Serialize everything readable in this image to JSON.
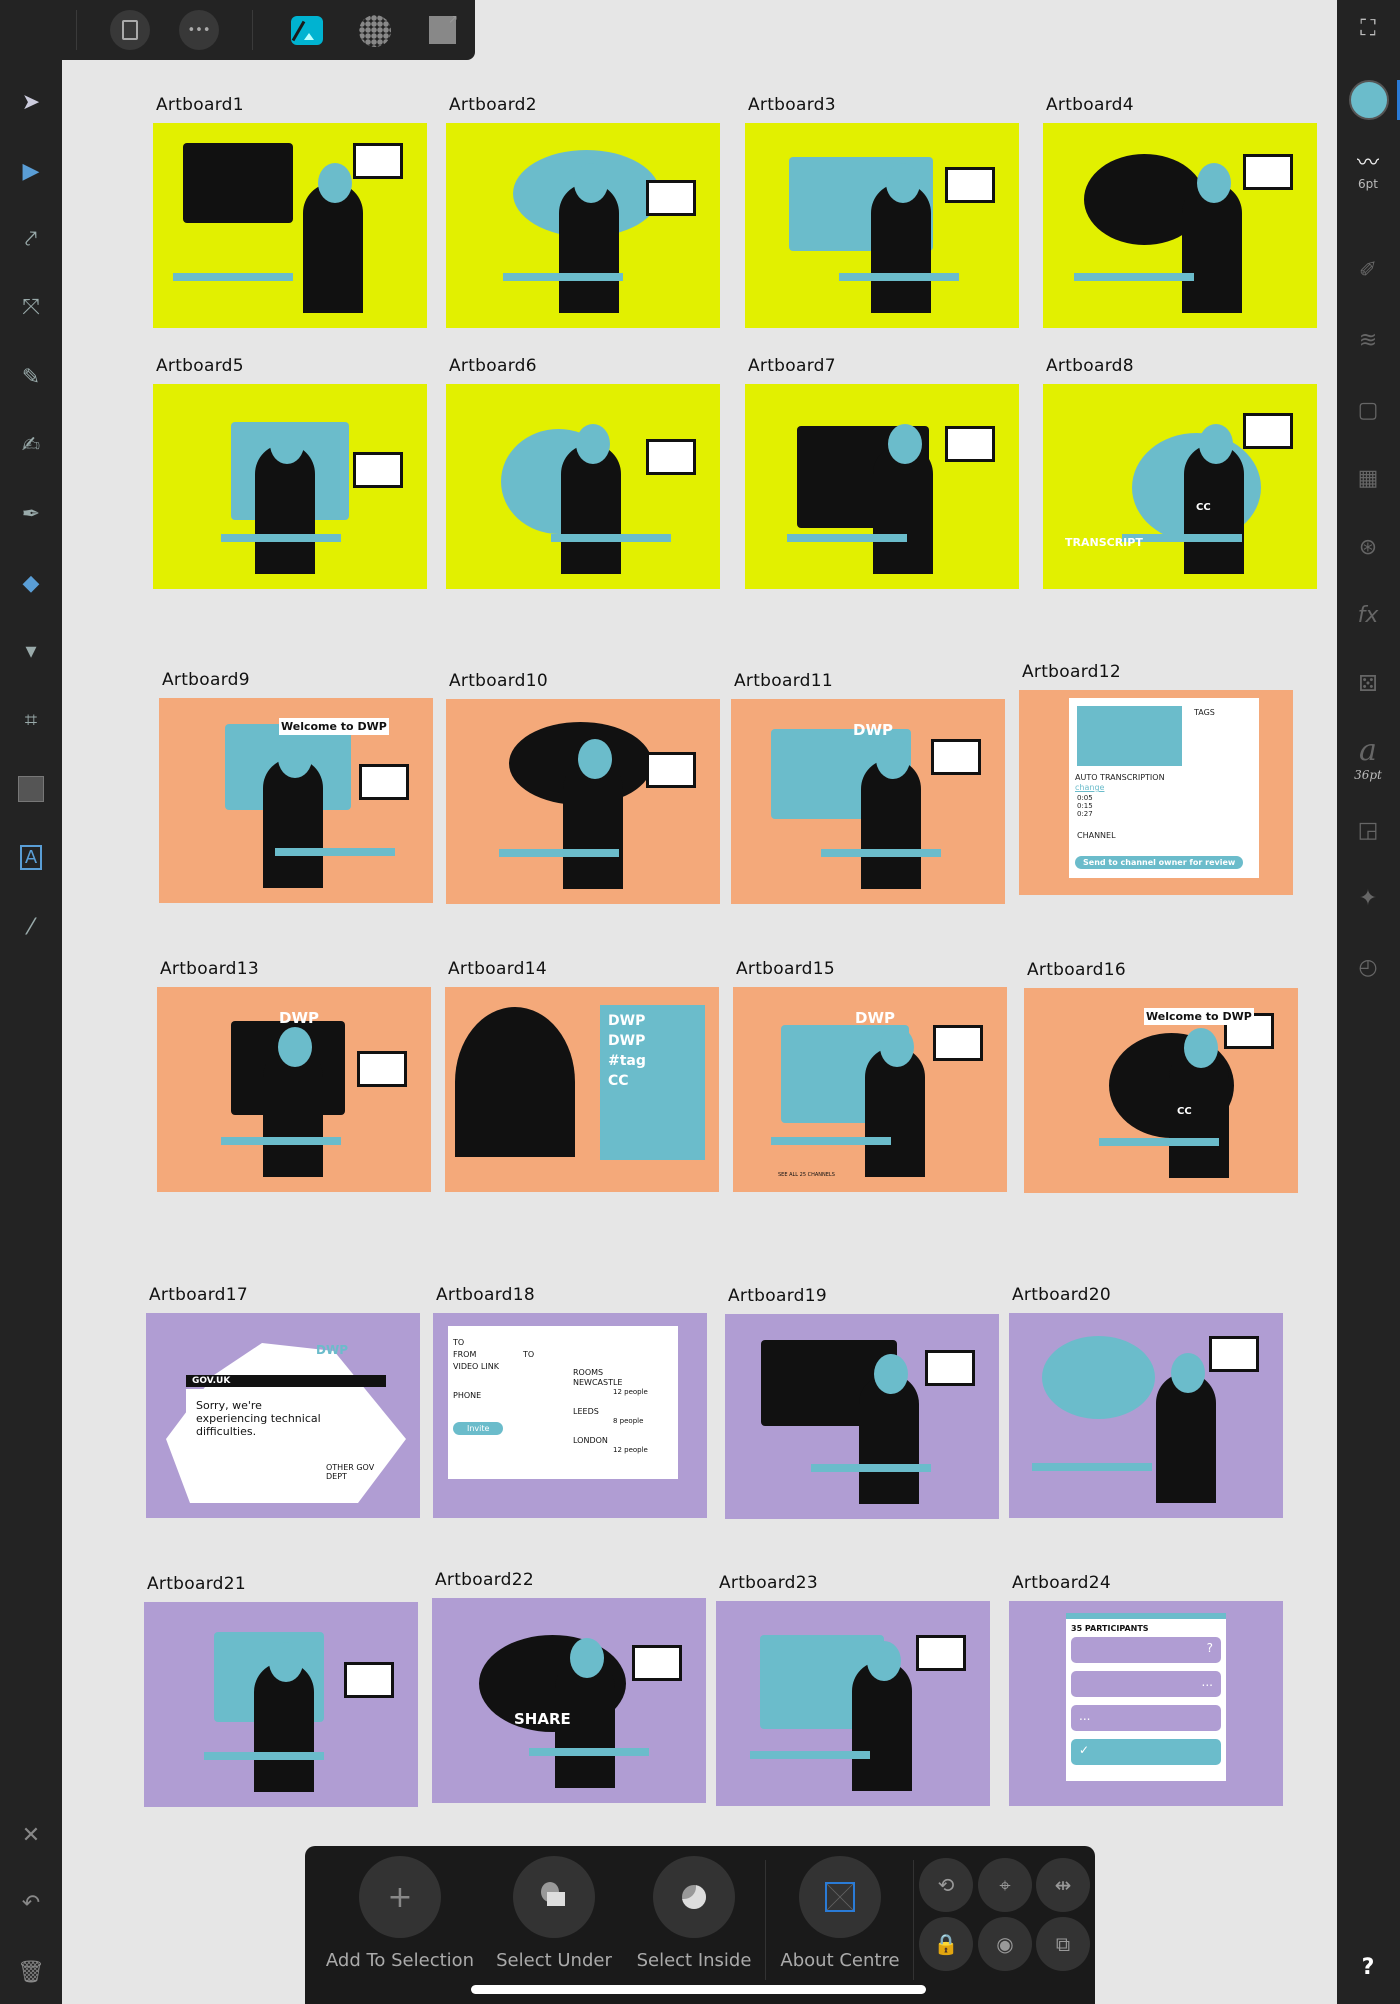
{
  "app": {
    "accent": "#00b3d1"
  },
  "topbar": {
    "icons": [
      "back-arrow-icon",
      "document-menu-icon",
      "more-icon",
      "designer-persona-icon",
      "pixel-persona-icon",
      "export-persona-icon"
    ],
    "more": "•••"
  },
  "left_tools": [
    "move-tool",
    "node-tool",
    "corner-tool",
    "point-transform-tool",
    "pencil-tool",
    "vector-brush-tool",
    "pen-tool",
    "fill-tool",
    "transparency-tool",
    "crop-tool",
    "shape-tool",
    "text-tool",
    "color-picker-tool"
  ],
  "right_panel": {
    "stroke_width": "6pt",
    "font_size": "36pt",
    "fill_color": "#6bbccb",
    "fx": "fx",
    "font_glyph": "a"
  },
  "theme_colors": {
    "yellow": "#e2f000",
    "orange": "#f4a97a",
    "purple": "#b09dd3",
    "teal": "#6bbccb",
    "black": "#111111"
  },
  "artboards": [
    {
      "name": "Artboard1",
      "theme": "yellow"
    },
    {
      "name": "Artboard2",
      "theme": "yellow"
    },
    {
      "name": "Artboard3",
      "theme": "yellow"
    },
    {
      "name": "Artboard4",
      "theme": "yellow"
    },
    {
      "name": "Artboard5",
      "theme": "yellow"
    },
    {
      "name": "Artboard6",
      "theme": "yellow"
    },
    {
      "name": "Artboard7",
      "theme": "yellow"
    },
    {
      "name": "Artboard8",
      "theme": "yellow",
      "text": "TRANSCRIPT",
      "cc": "CC"
    },
    {
      "name": "Artboard9",
      "theme": "orange",
      "text": "Welcome to DWP"
    },
    {
      "name": "Artboard10",
      "theme": "orange"
    },
    {
      "name": "Artboard11",
      "theme": "orange",
      "text": "DWP"
    },
    {
      "name": "Artboard12",
      "theme": "orange",
      "panel": {
        "tags": "TAGS",
        "auto": "AUTO TRANSCRIPTION",
        "change": "change",
        "times": [
          "0:05",
          "0:15",
          "0:27"
        ],
        "channel": "CHANNEL",
        "button": "Send to channel owner for review"
      }
    },
    {
      "name": "Artboard13",
      "theme": "orange",
      "text": "DWP"
    },
    {
      "name": "Artboard14",
      "theme": "orange",
      "list": [
        "DWP",
        "DWP",
        "#tag",
        "CC"
      ]
    },
    {
      "name": "Artboard15",
      "theme": "orange",
      "text": "DWP",
      "sub": "SEE ALL 25 CHANNELS"
    },
    {
      "name": "Artboard16",
      "theme": "orange",
      "text": "Welcome to DWP",
      "cc": "CC"
    },
    {
      "name": "Artboard17",
      "theme": "purple",
      "panel": {
        "dwp": "DWP",
        "govuk": "GOV.UK",
        "message": "Sorry, we're experiencing technical difficulties.",
        "other": "OTHER GOV DEPT"
      }
    },
    {
      "name": "Artboard18",
      "theme": "purple",
      "panel": {
        "to": "TO",
        "from": "FROM",
        "to2": "TO",
        "video": "VIDEO LINK",
        "phone": "PHONE",
        "invite": "Invite",
        "rooms": "ROOMS",
        "locations": [
          {
            "city": "NEWCASTLE",
            "people": "12 people"
          },
          {
            "city": "LEEDS",
            "people": "8 people"
          },
          {
            "city": "LONDON",
            "people": "12 people"
          }
        ]
      }
    },
    {
      "name": "Artboard19",
      "theme": "purple"
    },
    {
      "name": "Artboard20",
      "theme": "purple"
    },
    {
      "name": "Artboard21",
      "theme": "purple"
    },
    {
      "name": "Artboard22",
      "theme": "purple",
      "text": "SHARE"
    },
    {
      "name": "Artboard23",
      "theme": "purple"
    },
    {
      "name": "Artboard24",
      "theme": "purple",
      "panel": {
        "title": "35 PARTICIPANTS",
        "marks": [
          "?",
          "...",
          "...",
          "✓"
        ]
      }
    }
  ],
  "bottom_toolbar": {
    "buttons": [
      {
        "label": "Add To Selection",
        "icon": "+"
      },
      {
        "label": "Select Under",
        "icon": "select-under-icon"
      },
      {
        "label": "Select Inside",
        "icon": "select-inside-icon"
      },
      {
        "label": "About Centre",
        "icon": "transform-centre-icon"
      }
    ],
    "small": [
      "rotate-snap-icon",
      "crosshair-icon",
      "align-centre-icon",
      "lock-icon",
      "visibility-icon",
      "clone-icon"
    ]
  },
  "help": "?"
}
